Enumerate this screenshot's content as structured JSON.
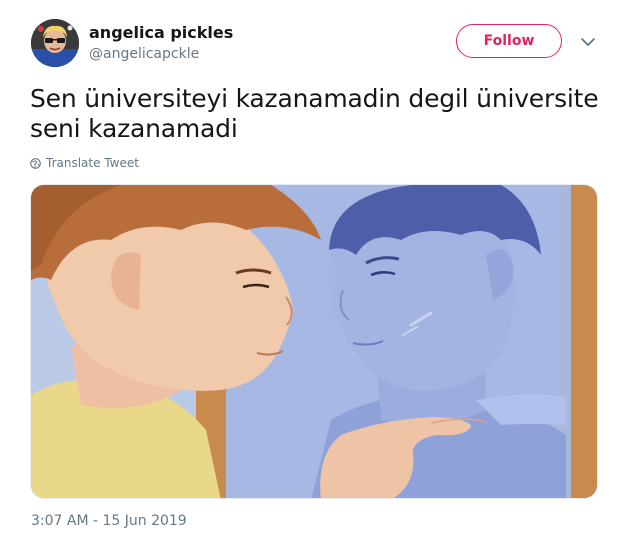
{
  "tweet": {
    "display_name": "angelica pickles",
    "handle": "@angelicapckle",
    "follow_label": "Follow",
    "text": "Sen üniversiteyi kazanamadin degil üniversite seni kazanamadi",
    "translate_label": "Translate Tweet",
    "timestamp": "3:07 AM - 15 Jun 2019"
  },
  "icons": {
    "caret": "chevron-down-icon",
    "translate": "globe-icon"
  },
  "colors": {
    "follow_accent": "#e0245e",
    "secondary_text": "#657786",
    "primary_text": "#14171a"
  }
}
